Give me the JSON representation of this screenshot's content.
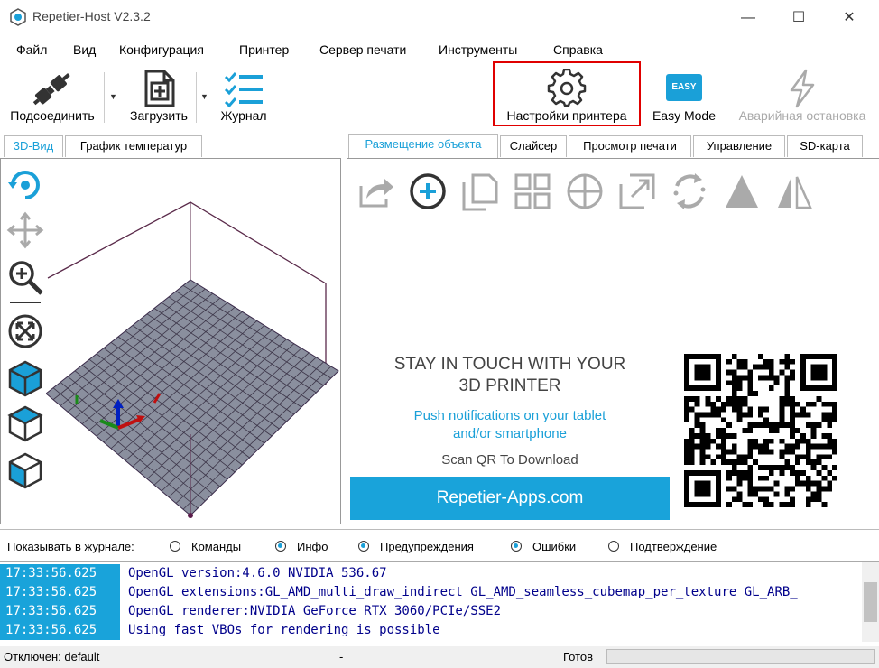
{
  "window": {
    "title": "Repetier-Host V2.3.2",
    "minimize": "—",
    "maximize": "☐",
    "close": "✕"
  },
  "menu": [
    "Файл",
    "Вид",
    "Конфигурация",
    "Принтер",
    "Сервер печати",
    "Инструменты",
    "Справка"
  ],
  "toolbar": {
    "connect": "Подсоединить",
    "load": "Загрузить",
    "log": "Журнал",
    "printer_settings": "Настройки принтера",
    "easy_mode": "Easy Mode",
    "easy_badge": "EASY",
    "emergency_stop": "Аварийная остановка"
  },
  "left_tabs": [
    "3D-Вид",
    "График температур"
  ],
  "right_tabs": [
    "Размещение объекта",
    "Слайсер",
    "Просмотр печати",
    "Управление",
    "SD-карта"
  ],
  "promo": {
    "headline_1": "STAY IN TOUCH WITH YOUR",
    "headline_2": "3D PRINTER",
    "sub_1": "Push notifications on your tablet",
    "sub_2": "and/or smartphone",
    "scan": "Scan QR To Download",
    "button": "Repetier-Apps.com"
  },
  "log_filter": {
    "label": "Показывать в журнале:",
    "options": [
      {
        "label": "Команды",
        "checked": false
      },
      {
        "label": "Инфо",
        "checked": true
      },
      {
        "label": "Предупреждения",
        "checked": true
      },
      {
        "label": "Ошибки",
        "checked": true
      },
      {
        "label": "Подтверждение",
        "checked": false
      }
    ]
  },
  "log": [
    {
      "time": "17:33:56.625",
      "msg": "OpenGL version:4.6.0 NVIDIA 536.67"
    },
    {
      "time": "17:33:56.625",
      "msg": "OpenGL extensions:GL_AMD_multi_draw_indirect GL_AMD_seamless_cubemap_per_texture GL_ARB_"
    },
    {
      "time": "17:33:56.625",
      "msg": "OpenGL renderer:NVIDIA GeForce RTX 3060/PCIe/SSE2"
    },
    {
      "time": "17:33:56.625",
      "msg": "Using fast VBOs for rendering is possible"
    }
  ],
  "status": {
    "connection": "Отключен: default",
    "middle": "-",
    "state": "Готов"
  },
  "colors": {
    "accent": "#1aa0d8",
    "highlight_box": "#e00000",
    "bed": "#8a8f9e"
  }
}
